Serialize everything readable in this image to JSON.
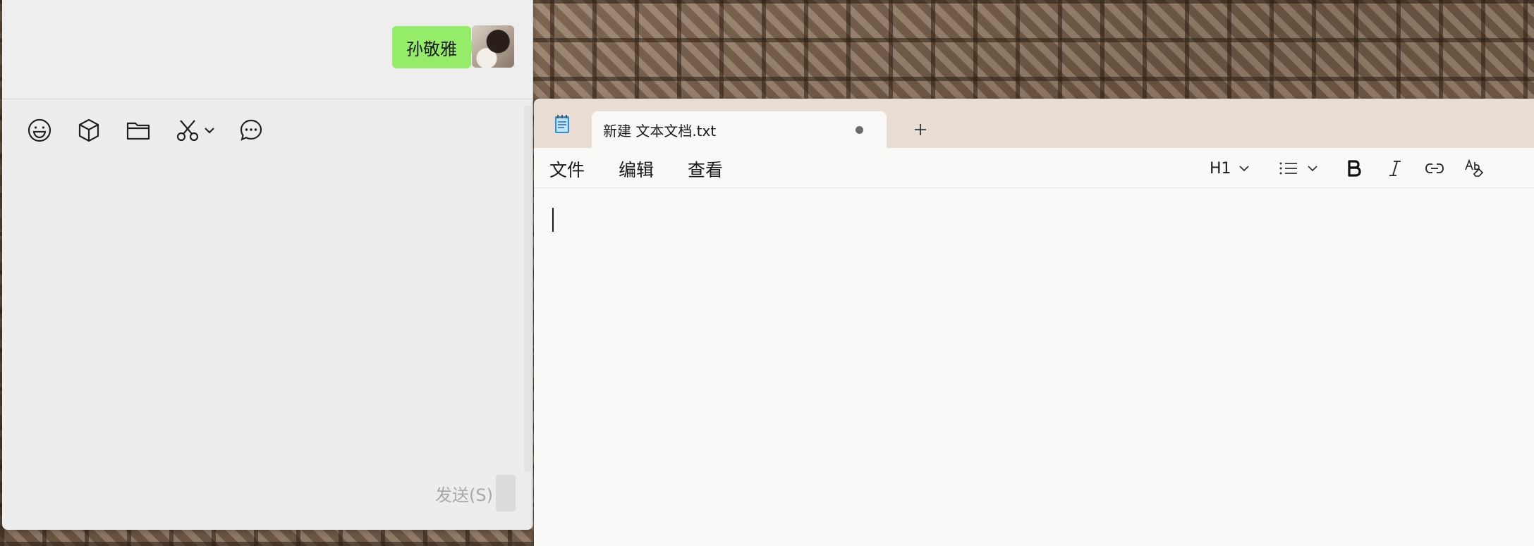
{
  "chat": {
    "message_text": "孙敬雅",
    "send_label": "发送(S)",
    "toolbar_icons": [
      "emoji-icon",
      "box-icon",
      "folder-icon",
      "scissors-icon",
      "chevron-down-icon",
      "chat-history-icon"
    ],
    "bubble_color": "#95ec69"
  },
  "notepad": {
    "tab_title": "新建 文本文档.txt",
    "new_tab_symbol": "+",
    "menu": {
      "file": "文件",
      "edit": "编辑",
      "view": "查看"
    },
    "format": {
      "heading": "H1",
      "icons": [
        "list-icon",
        "bold-icon",
        "italic-icon",
        "link-icon",
        "clear-format-icon"
      ]
    },
    "editor_text": ""
  }
}
